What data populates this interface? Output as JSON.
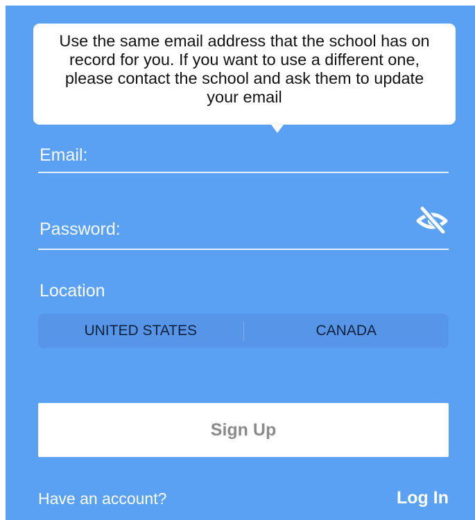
{
  "tooltip": {
    "line1": "Use the same email address that the school has on",
    "line2": "record for you. If you want to use a different one,",
    "line3": "please contact the school and ask them to update",
    "line4": "your email"
  },
  "form": {
    "email_placeholder": "Email:",
    "email_value": "",
    "password_placeholder": "Password:",
    "password_value": "",
    "password_toggle_icon": "eye-slash-icon",
    "location_label": "Location",
    "location_options": [
      "UNITED STATES",
      "CANADA"
    ],
    "signup_label": "Sign Up"
  },
  "footer": {
    "have_account": "Have an account?",
    "login_label": "Log In"
  },
  "colors": {
    "background": "#5aa1f4",
    "segmented_bg": "#5695e7",
    "button_bg": "#ffffff",
    "button_text": "#8b8b8b"
  }
}
